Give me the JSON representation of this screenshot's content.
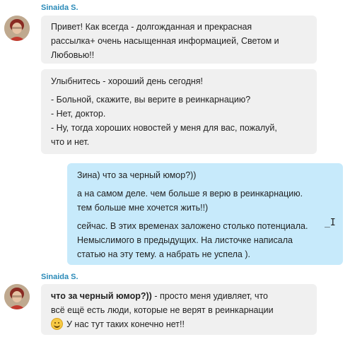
{
  "sender_name": "Sinaida S.",
  "messages": [
    {
      "lines": [
        "Привет! Как всегда - долгожданная и прекрасная",
        "рассылка+ очень насыщенная информацией, Светом и",
        "Любовью!!"
      ]
    },
    {
      "lines": [
        "Улыбнитесь - хороший день сегодня!",
        "- Больной, скажите, вы верите в реинкарнацию?",
        "- Нет, доктор.",
        "- Ну, тогда хороших новостей у меня для вас, пожалуй,",
        "что и нет."
      ]
    }
  ],
  "reply": {
    "lines": [
      "Зина) что за черный юмор?))",
      "а на самом деле. чем больше я верю в реинкарнацию.",
      "тем больше мне хочется жить!!)",
      "сейчас. В этих временах заложено столько потенциала.",
      "Немыслимого в предыдущих. На листочке написала",
      "статью на эту тему. а набрать не успела )."
    ]
  },
  "second_block": {
    "quote": "что за черный юмор?))",
    "line1_rest": " - просто меня удивляет, что",
    "line2": "всё ещё есть люди, которые не верят в реинкарнации",
    "line3": "У нас тут таких конечно нет!!"
  },
  "icons": {
    "avatar": "user-avatar",
    "emoji": "smiling-face-emoji",
    "cursor": "text-cursor-icon"
  }
}
